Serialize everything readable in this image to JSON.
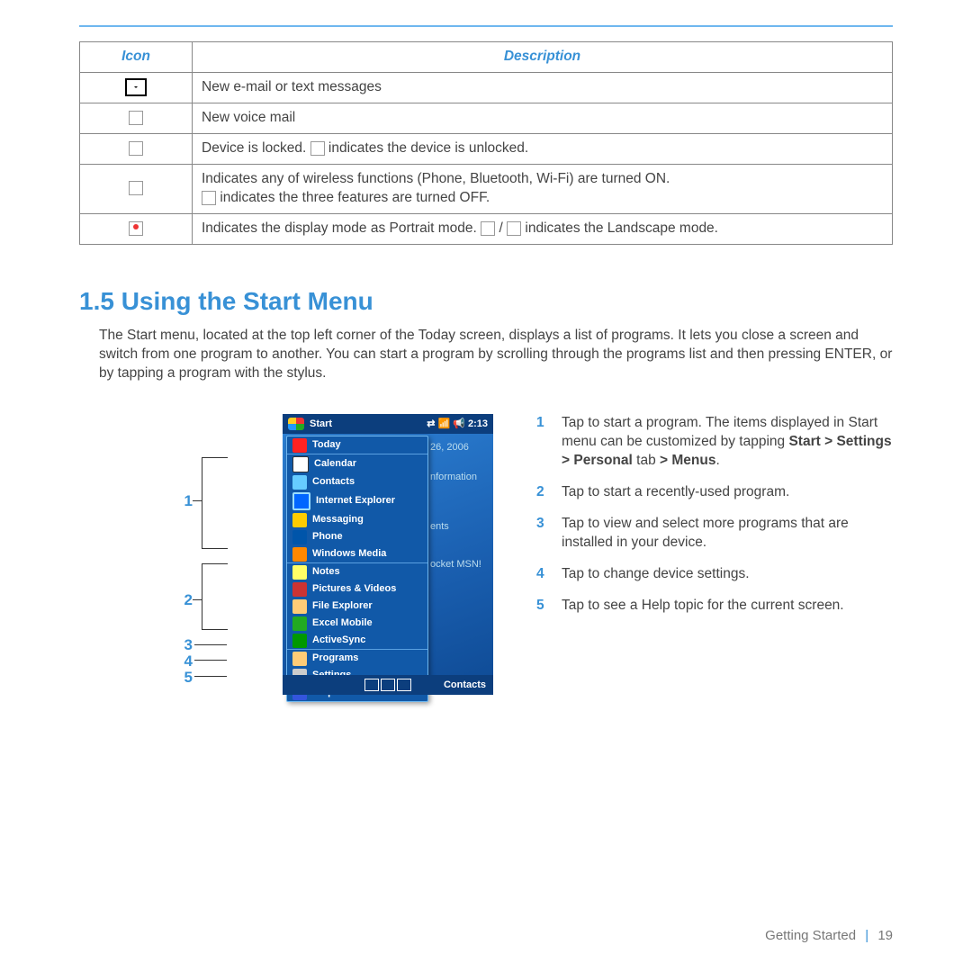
{
  "table": {
    "headers": {
      "icon": "Icon",
      "desc": "Description"
    },
    "rows": [
      {
        "desc": "New e-mail or text messages"
      },
      {
        "desc": "New voice mail"
      },
      {
        "desc1": "Device is locked. ",
        "desc2": " indicates the device is unlocked."
      },
      {
        "desc1": "Indicates any of wireless functions (Phone, Bluetooth, Wi-Fi) are turned ON.",
        "desc2": " indicates the three features are turned OFF."
      },
      {
        "desc1": "Indicates the display mode as Portrait mode. ",
        "desc2": " / ",
        "desc3": " indicates the Landscape mode."
      }
    ]
  },
  "section": {
    "heading": "1.5 Using the Start Menu",
    "body": "The Start menu, located at the top left corner of the Today screen, displays a list of programs. It lets you close a screen and switch from one program to another. You can start a program by scrolling through the programs list and then pressing ENTER, or by tapping a program with the stylus."
  },
  "callouts": [
    "1",
    "2",
    "3",
    "4",
    "5"
  ],
  "phone": {
    "start": "Start",
    "time": "2:13",
    "behind_date": "26, 2006",
    "behind_info": "nformation",
    "behind_ents": "ents",
    "behind_msn": "ocket MSN!",
    "items1": [
      "Today",
      "Calendar",
      "Contacts",
      "Internet Explorer",
      "Messaging",
      "Phone",
      "Windows Media"
    ],
    "items2": [
      "Notes",
      "Pictures & Videos",
      "File Explorer",
      "Excel Mobile",
      "ActiveSync"
    ],
    "items3": [
      "Programs",
      "Settings",
      "Help"
    ],
    "softkey_right": "Contacts"
  },
  "legend": {
    "1a": "Tap to start a program. The items displayed in Start menu can be customized by tapping ",
    "1b": "Start > Settings > Personal",
    "1c": " tab ",
    "1d": "> Menus",
    "1e": ".",
    "2": "Tap to start a recently-used program.",
    "3": "Tap to view and select more programs that are installed in your device.",
    "4": "Tap to change device settings.",
    "5": "Tap to see a Help topic for the current screen."
  },
  "footer": {
    "chapter": "Getting Started",
    "page": "19"
  }
}
